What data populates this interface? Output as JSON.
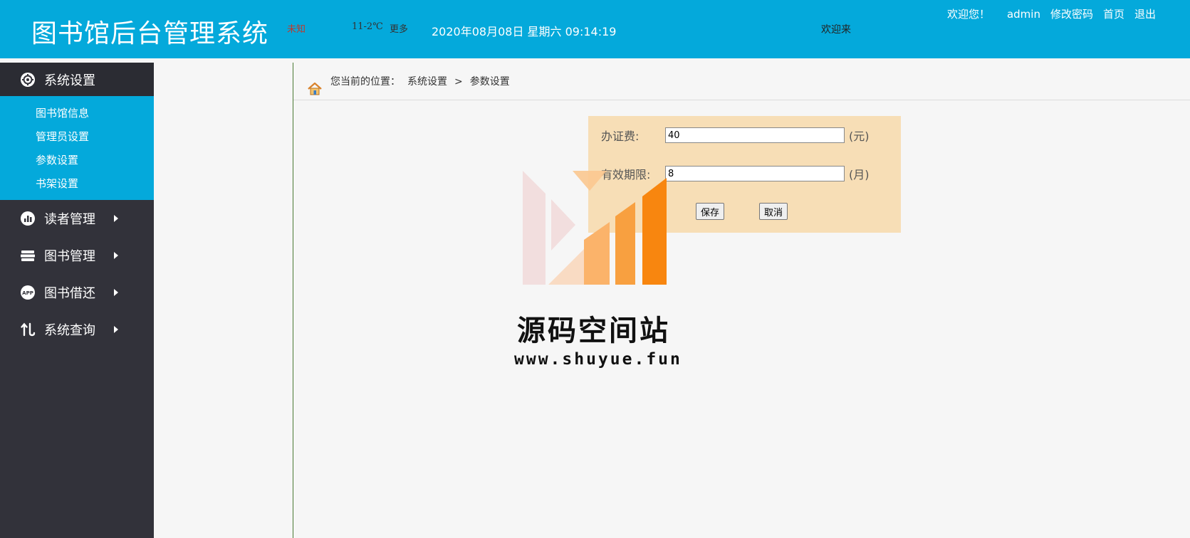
{
  "header": {
    "title": "图书馆后台管理系统",
    "weather_city": "未知",
    "weather_temp": "11-2℃",
    "weather_more": "更多",
    "datetime": "2020年08月08日 星期六 09:14:19",
    "marquee": "欢迎来",
    "welcome": "欢迎您！",
    "username": "admin",
    "change_password": "修改密码",
    "home": "首页",
    "logout": "退出"
  },
  "sidebar": {
    "items": [
      {
        "label": "系统设置",
        "icon": "gear-icon",
        "expanded": true,
        "children": [
          "图书馆信息",
          "管理员设置",
          "参数设置",
          "书架设置"
        ]
      },
      {
        "label": "读者管理",
        "icon": "chart-icon"
      },
      {
        "label": "图书管理",
        "icon": "books-icon"
      },
      {
        "label": "图书借还",
        "icon": "app-icon"
      },
      {
        "label": "系统查询",
        "icon": "swap-icon"
      }
    ]
  },
  "breadcrumb": {
    "prefix": "您当前的位置：",
    "level1": "系统设置",
    "separator": ">",
    "level2": "参数设置"
  },
  "form": {
    "fee_label": "办证费:",
    "fee_value": "40",
    "fee_unit": "(元)",
    "validity_label": "有效期限:",
    "validity_value": "8",
    "validity_unit": "(月)",
    "save_label": "保存",
    "cancel_label": "取消"
  },
  "watermark": {
    "title": "源码空间站",
    "url": "www.shuyue.fun"
  },
  "colors": {
    "header_bg": "#04a9db",
    "sidebar_bg": "#32323a",
    "submenu_bg": "#04a9db",
    "form_bg": "#f7deb6"
  }
}
